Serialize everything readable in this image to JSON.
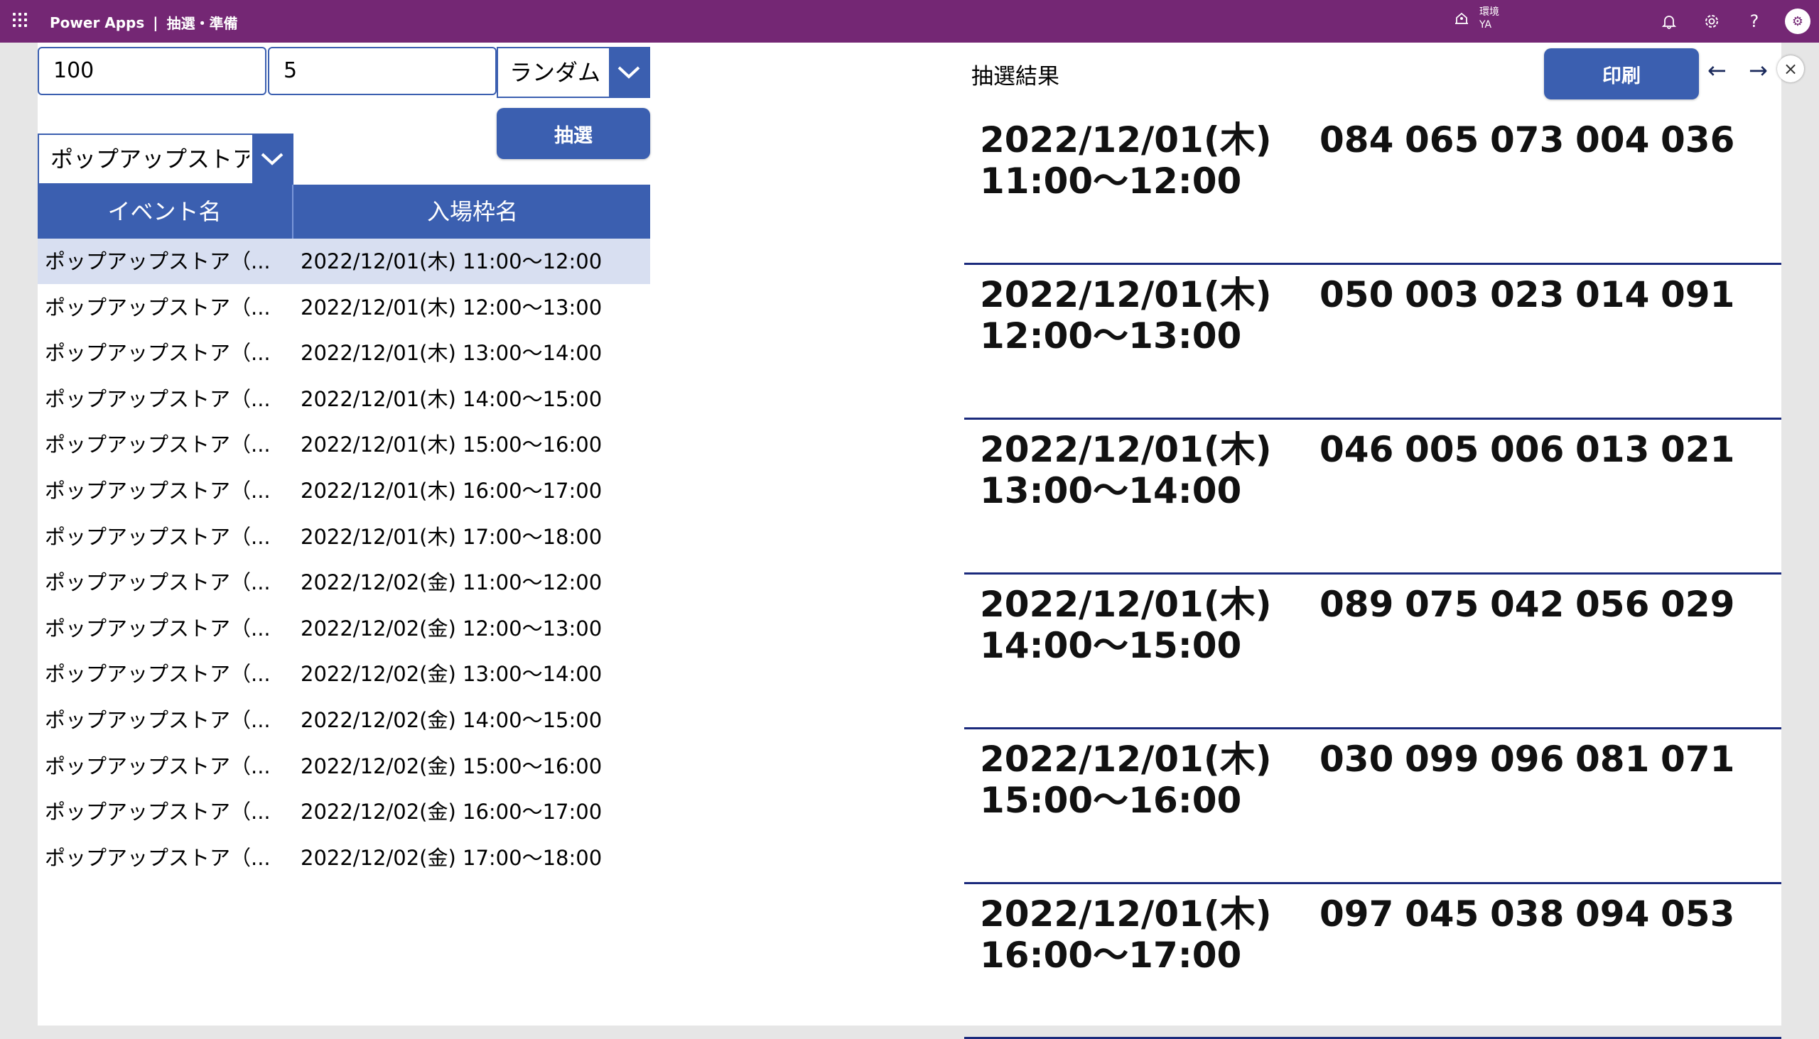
{
  "header": {
    "app_name": "Power Apps",
    "separator": "|",
    "screen_title": "抽選・準備",
    "env_label": "環境",
    "env_name": "YA",
    "colors": {
      "bar": "#742774",
      "accent": "#3b5fb0",
      "rule": "#1b2a7c"
    }
  },
  "controls": {
    "total_input": "100",
    "count_input": "5",
    "mode_dropdown": "ランダム",
    "event_dropdown": "ポップアップストア（",
    "draw_button": "抽選",
    "print_button": "印刷"
  },
  "table": {
    "headers": [
      "イベント名",
      "入場枠名"
    ],
    "rows": [
      {
        "event": "ポップアップストア（...",
        "slot": "2022/12/01(木) 11:00～12:00"
      },
      {
        "event": "ポップアップストア（...",
        "slot": "2022/12/01(木) 12:00～13:00"
      },
      {
        "event": "ポップアップストア（...",
        "slot": "2022/12/01(木) 13:00～14:00"
      },
      {
        "event": "ポップアップストア（...",
        "slot": "2022/12/01(木) 14:00～15:00"
      },
      {
        "event": "ポップアップストア（...",
        "slot": "2022/12/01(木) 15:00～16:00"
      },
      {
        "event": "ポップアップストア（...",
        "slot": "2022/12/01(木) 16:00～17:00"
      },
      {
        "event": "ポップアップストア（...",
        "slot": "2022/12/01(木) 17:00～18:00"
      },
      {
        "event": "ポップアップストア（...",
        "slot": "2022/12/02(金) 11:00～12:00"
      },
      {
        "event": "ポップアップストア（...",
        "slot": "2022/12/02(金) 12:00～13:00"
      },
      {
        "event": "ポップアップストア（...",
        "slot": "2022/12/02(金) 13:00～14:00"
      },
      {
        "event": "ポップアップストア（...",
        "slot": "2022/12/02(金) 14:00～15:00"
      },
      {
        "event": "ポップアップストア（...",
        "slot": "2022/12/02(金) 15:00～16:00"
      },
      {
        "event": "ポップアップストア（...",
        "slot": "2022/12/02(金) 16:00～17:00"
      },
      {
        "event": "ポップアップストア（...",
        "slot": "2022/12/02(金) 17:00～18:00"
      }
    ]
  },
  "results": {
    "title": "抽選結果",
    "prev_arrow": "←",
    "next_arrow": "→",
    "close": "×",
    "items": [
      {
        "date": "2022/12/01(木)",
        "time": "11:00～12:00",
        "numbers": [
          "084",
          "065",
          "073",
          "004",
          "036"
        ]
      },
      {
        "date": "2022/12/01(木)",
        "time": "12:00～13:00",
        "numbers": [
          "050",
          "003",
          "023",
          "014",
          "091"
        ]
      },
      {
        "date": "2022/12/01(木)",
        "time": "13:00～14:00",
        "numbers": [
          "046",
          "005",
          "006",
          "013",
          "021"
        ]
      },
      {
        "date": "2022/12/01(木)",
        "time": "14:00～15:00",
        "numbers": [
          "089",
          "075",
          "042",
          "056",
          "029"
        ]
      },
      {
        "date": "2022/12/01(木)",
        "time": "15:00～16:00",
        "numbers": [
          "030",
          "099",
          "096",
          "081",
          "071"
        ]
      },
      {
        "date": "2022/12/01(木)",
        "time": "16:00～17:00",
        "numbers": [
          "097",
          "045",
          "038",
          "094",
          "053"
        ]
      }
    ]
  }
}
